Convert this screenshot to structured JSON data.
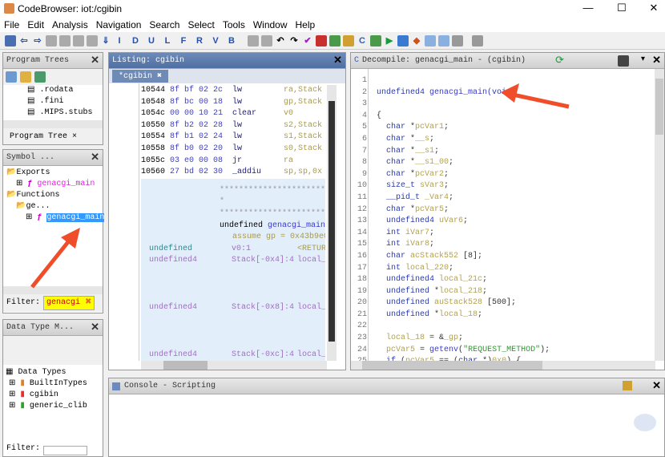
{
  "window": {
    "title": "CodeBrowser: iot:/cgibin",
    "minimize": "—",
    "maximize": "☐",
    "close": "✕"
  },
  "menu": [
    "File",
    "Edit",
    "Analysis",
    "Navigation",
    "Search",
    "Select",
    "Tools",
    "Window",
    "Help"
  ],
  "toolbar": {
    "letters": [
      "I",
      "D",
      "U",
      "L",
      "F",
      "R",
      "V",
      "B"
    ]
  },
  "program_trees": {
    "title": "Program Trees",
    "items": [
      ".rodata",
      ".fini",
      ".MIPS.stubs"
    ],
    "tab": "Program Tree"
  },
  "symbol_tree": {
    "title": "Symbol ...",
    "items": [
      {
        "label": "Exports",
        "level": 0
      },
      {
        "label": "genacgi_main",
        "level": 1,
        "type": "function"
      },
      {
        "label": "Functions",
        "level": 0
      },
      {
        "label": "ge...",
        "level": 1
      },
      {
        "label": "genacgi_main",
        "level": 2,
        "type": "function",
        "selected": true
      }
    ],
    "filter_label": "Filter:",
    "filter_value": "genacgi"
  },
  "data_types": {
    "title": "Data Type M...",
    "root": "Data Types",
    "items": [
      "BuiltInTypes",
      "cgibin",
      "generic_clib"
    ],
    "filter_label": "Filter:",
    "filter_value": ""
  },
  "listing": {
    "title": "Listing: cgibin",
    "tab": "*cgibin",
    "rows": [
      [
        "10544",
        "8f bf 02 2c",
        "lw",
        "ra,Stack"
      ],
      [
        "10548",
        "8f bc 00 18",
        "lw",
        "gp,Stack"
      ],
      [
        "1054c",
        "00 00 10 21",
        "clear",
        "v0"
      ],
      [
        "10550",
        "8f b2 02 28",
        "lw",
        "s2,Stack"
      ],
      [
        "10554",
        "8f b1 02 24",
        "lw",
        "s1,Stack"
      ],
      [
        "10558",
        "8f b0 02 20",
        "lw",
        "s0,Stack"
      ],
      [
        "1055c",
        "03 e0 00 08",
        "jr",
        "ra"
      ],
      [
        "10560",
        "27 bd 02 30",
        "_addiu",
        "sp,sp,0x"
      ]
    ],
    "stars": "************************",
    "star_mid": "*",
    "func_sig_type": "undefined",
    "func_sig_name": "genacgi_main(",
    "assume": "assume gp = 0x43b9e0",
    "params": [
      [
        "undefined",
        "v0:1",
        "<RETUR"
      ],
      [
        "undefined4",
        "Stack[-0x4]:4",
        "local_"
      ],
      [
        "undefined4",
        "Stack[-0x8]:4",
        "local_"
      ],
      [
        "undefined4",
        "Stack[-0xc]:4",
        "local_"
      ]
    ]
  },
  "decompile": {
    "title": "Decompile: genacgi_main -  (cgibin)",
    "lines": [
      [],
      [
        [
          "kw",
          "undefined4 "
        ],
        [
          "fn",
          "genacgi_main"
        ],
        [
          "kw",
          "(void)"
        ]
      ],
      [],
      [
        [
          "pu",
          "{"
        ]
      ],
      [
        [
          "kw",
          "  char "
        ],
        [
          "pu",
          "*"
        ],
        [
          "var",
          "pcVar1"
        ],
        [
          "pu",
          ";"
        ]
      ],
      [
        [
          "kw",
          "  char "
        ],
        [
          "pu",
          "*"
        ],
        [
          "var",
          "__s"
        ],
        [
          "pu",
          ";"
        ]
      ],
      [
        [
          "kw",
          "  char "
        ],
        [
          "pu",
          "*"
        ],
        [
          "var",
          "__s1"
        ],
        [
          "pu",
          ";"
        ]
      ],
      [
        [
          "kw",
          "  char "
        ],
        [
          "pu",
          "*"
        ],
        [
          "var",
          "__s1_00"
        ],
        [
          "pu",
          ";"
        ]
      ],
      [
        [
          "kw",
          "  char "
        ],
        [
          "pu",
          "*"
        ],
        [
          "var",
          "pcVar2"
        ],
        [
          "pu",
          ";"
        ]
      ],
      [
        [
          "kw",
          "  size_t "
        ],
        [
          "var",
          "sVar3"
        ],
        [
          "pu",
          ";"
        ]
      ],
      [
        [
          "kw",
          "  __pid_t "
        ],
        [
          "var",
          "_Var4"
        ],
        [
          "pu",
          ";"
        ]
      ],
      [
        [
          "kw",
          "  char "
        ],
        [
          "pu",
          "*"
        ],
        [
          "var",
          "pcVar5"
        ],
        [
          "pu",
          ";"
        ]
      ],
      [
        [
          "kw",
          "  undefined4 "
        ],
        [
          "var",
          "uVar6"
        ],
        [
          "pu",
          ";"
        ]
      ],
      [
        [
          "kw",
          "  int "
        ],
        [
          "var",
          "iVar7"
        ],
        [
          "pu",
          ";"
        ]
      ],
      [
        [
          "kw",
          "  int "
        ],
        [
          "var",
          "iVar8"
        ],
        [
          "pu",
          ";"
        ]
      ],
      [
        [
          "kw",
          "  char "
        ],
        [
          "var",
          "acStack552 "
        ],
        [
          "pu",
          "[8];"
        ]
      ],
      [
        [
          "kw",
          "  int "
        ],
        [
          "var",
          "local_220"
        ],
        [
          "pu",
          ";"
        ]
      ],
      [
        [
          "kw",
          "  undefined4 "
        ],
        [
          "var",
          "local_21c"
        ],
        [
          "pu",
          ";"
        ]
      ],
      [
        [
          "kw",
          "  undefined "
        ],
        [
          "pu",
          "*"
        ],
        [
          "var",
          "local_218"
        ],
        [
          "pu",
          ";"
        ]
      ],
      [
        [
          "kw",
          "  undefined "
        ],
        [
          "var",
          "auStack528 "
        ],
        [
          "pu",
          "[500];"
        ]
      ],
      [
        [
          "kw",
          "  undefined "
        ],
        [
          "pu",
          "*"
        ],
        [
          "var",
          "local_18"
        ],
        [
          "pu",
          ";"
        ]
      ],
      [],
      [
        [
          "var",
          "  local_18"
        ],
        [
          "pu",
          " = &"
        ],
        [
          "var",
          "_gp"
        ],
        [
          "pu",
          ";"
        ]
      ],
      [
        [
          "var",
          "  pcVar5"
        ],
        [
          "pu",
          " = "
        ],
        [
          "fn",
          "getenv"
        ],
        [
          "pu",
          "("
        ],
        [
          "str",
          "\"REQUEST_METHOD\""
        ],
        [
          "pu",
          ");"
        ]
      ],
      [
        [
          "kw",
          "  if "
        ],
        [
          "pu",
          "("
        ],
        [
          "var",
          "pcVar5"
        ],
        [
          "pu",
          " == ("
        ],
        [
          "kw",
          "char "
        ],
        [
          "pu",
          "*)"
        ],
        [
          "var",
          "0x0"
        ],
        [
          "pu",
          ") {"
        ]
      ]
    ]
  },
  "console": {
    "title": "Console - Scripting"
  },
  "colors": {
    "accent": "#4f6fa3",
    "selection": "#3399ff",
    "annotation_arrow": "#f04e2a",
    "filter_highlight": "#ffff00"
  }
}
